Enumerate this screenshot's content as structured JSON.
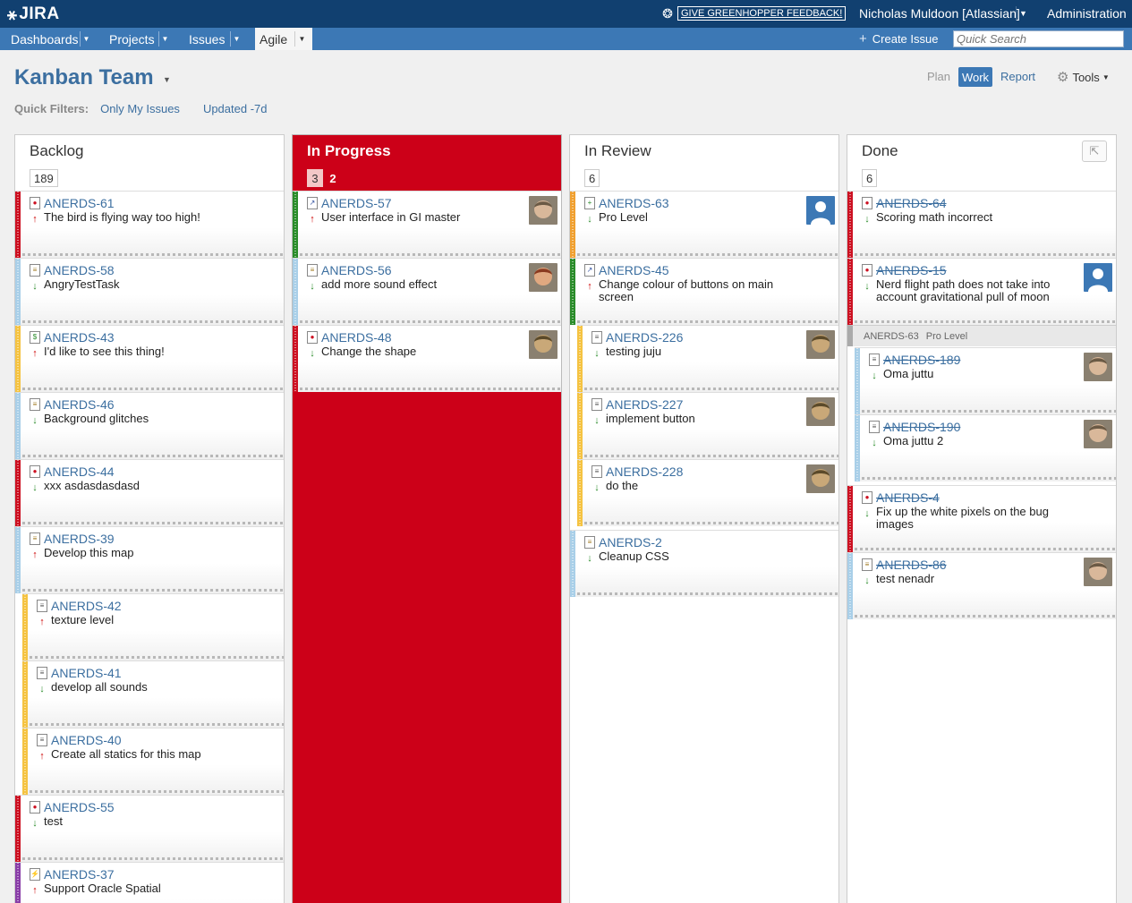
{
  "header": {
    "logo": "JIRA",
    "feedback": "GIVE GREENHOPPER FEEDBACK!",
    "user": "Nicholas Muldoon [Atlassian]",
    "admin": "Administration"
  },
  "nav": {
    "dashboards": "Dashboards",
    "projects": "Projects",
    "issues": "Issues",
    "agile": "Agile",
    "create_issue": "Create Issue",
    "search_placeholder": "Quick Search"
  },
  "board": {
    "title": "Kanban Team",
    "quick_filters_label": "Quick Filters:",
    "filters": [
      "Only My Issues",
      "Updated -7d"
    ],
    "modes": {
      "plan": "Plan",
      "work": "Work",
      "report": "Report",
      "tools": "Tools"
    }
  },
  "columns": [
    {
      "title": "Backlog",
      "count": "189"
    },
    {
      "title": "In Progress",
      "count_a": "3",
      "count_b": "2"
    },
    {
      "title": "In Review",
      "count": "6"
    },
    {
      "title": "Done",
      "count": "6"
    }
  ],
  "colors": {
    "header_bg": "#114070",
    "nav_bg": "#3c78b5",
    "link": "#3c6fa0",
    "in_progress": "#cc0018",
    "stripe_red": "#cc1122",
    "stripe_yellow": "#f5c342",
    "stripe_blue": "#a9cfe8",
    "stripe_green": "#2a8c2a",
    "stripe_orange": "#f0a030",
    "stripe_purple": "#8a3fa8",
    "gray_bar": "#aaaaaa"
  },
  "cards": {
    "backlog": [
      {
        "key": "ANERDS-61",
        "summary": "The bird is flying way too high!",
        "priority": "up",
        "type": "bug",
        "stripe": "red"
      },
      {
        "key": "ANERDS-58",
        "summary": "AngryTestTask",
        "priority": "down",
        "type": "task",
        "stripe": "blue"
      },
      {
        "key": "ANERDS-43",
        "summary": "I'd like to see this thing!",
        "priority": "up",
        "type": "improvement",
        "stripe": "yellow"
      },
      {
        "key": "ANERDS-46",
        "summary": "Background glitches",
        "priority": "down",
        "type": "task",
        "stripe": "blue"
      },
      {
        "key": "ANERDS-44",
        "summary": "xxx asdasdasdasd",
        "priority": "down",
        "type": "bug",
        "stripe": "red"
      },
      {
        "key": "ANERDS-39",
        "summary": "Develop this map",
        "priority": "up",
        "type": "task",
        "stripe": "blue"
      },
      {
        "key": "ANERDS-42",
        "summary": "texture level",
        "priority": "up",
        "type": "subtask",
        "stripe": "yellow"
      },
      {
        "key": "ANERDS-41",
        "summary": "develop all sounds",
        "priority": "down",
        "type": "subtask",
        "stripe": "yellow"
      },
      {
        "key": "ANERDS-40",
        "summary": "Create all statics for this map",
        "priority": "up",
        "type": "subtask",
        "stripe": "yellow"
      },
      {
        "key": "ANERDS-55",
        "summary": "test",
        "priority": "down",
        "type": "bug",
        "stripe": "red"
      },
      {
        "key": "ANERDS-37",
        "summary": "Support Oracle Spatial",
        "priority": "up",
        "type": "story",
        "stripe": "purple"
      }
    ],
    "inprogress": [
      {
        "key": "ANERDS-57",
        "summary": "User interface in GI master",
        "priority": "up",
        "type": "feature",
        "stripe": "green",
        "avatar": "face-a"
      },
      {
        "key": "ANERDS-56",
        "summary": "add more sound effect",
        "priority": "down",
        "type": "task",
        "stripe": "blue",
        "avatar": "face-b"
      },
      {
        "key": "ANERDS-48",
        "summary": "Change the shape",
        "priority": "down",
        "type": "bug",
        "stripe": "red",
        "avatar": "face-c"
      }
    ],
    "inreview": [
      {
        "key": "ANERDS-63",
        "summary": "Pro Level",
        "priority": "down",
        "type": "newfeature",
        "stripe": "orange",
        "avatar": "default"
      },
      {
        "key": "ANERDS-45",
        "summary": "Change colour of buttons on main screen",
        "priority": "up",
        "type": "feature",
        "stripe": "green"
      },
      {
        "key": "ANERDS-226",
        "summary": "testing juju",
        "priority": "down",
        "type": "subtask",
        "stripe": "yellow",
        "avatar": "face-c"
      },
      {
        "key": "ANERDS-227",
        "summary": "implement button",
        "priority": "down",
        "type": "subtask",
        "stripe": "yellow",
        "avatar": "face-c"
      },
      {
        "key": "ANERDS-228",
        "summary": "do the",
        "priority": "down",
        "type": "subtask",
        "stripe": "yellow",
        "avatar": "face-c"
      },
      {
        "key": "ANERDS-2",
        "summary": "Cleanup CSS",
        "priority": "down",
        "type": "task",
        "stripe": "blue"
      }
    ],
    "done": [
      {
        "key": "ANERDS-64",
        "summary": "Scoring math incorrect",
        "priority": "down",
        "type": "bug",
        "stripe": "red"
      },
      {
        "key": "ANERDS-15",
        "summary": "Nerd flight path does not take into account gravitational pull of moon",
        "priority": "down",
        "type": "bug",
        "stripe": "red",
        "avatar": "default"
      },
      {
        "key": "ANERDS-189",
        "summary": "Oma juttu",
        "priority": "down",
        "type": "subtask",
        "stripe": "blue",
        "avatar": "face-a"
      },
      {
        "key": "ANERDS-190",
        "summary": "Oma juttu 2",
        "priority": "down",
        "type": "subtask",
        "stripe": "blue",
        "avatar": "face-a"
      },
      {
        "key": "ANERDS-4",
        "summary": "Fix up the white pixels on the bug images",
        "priority": "down",
        "type": "bug",
        "stripe": "red"
      },
      {
        "key": "ANERDS-86",
        "summary": "test nenadr",
        "priority": "down",
        "type": "task",
        "stripe": "blue",
        "avatar": "face-a"
      }
    ],
    "done_parent": {
      "key": "ANERDS-63",
      "summary": "Pro Level"
    }
  }
}
